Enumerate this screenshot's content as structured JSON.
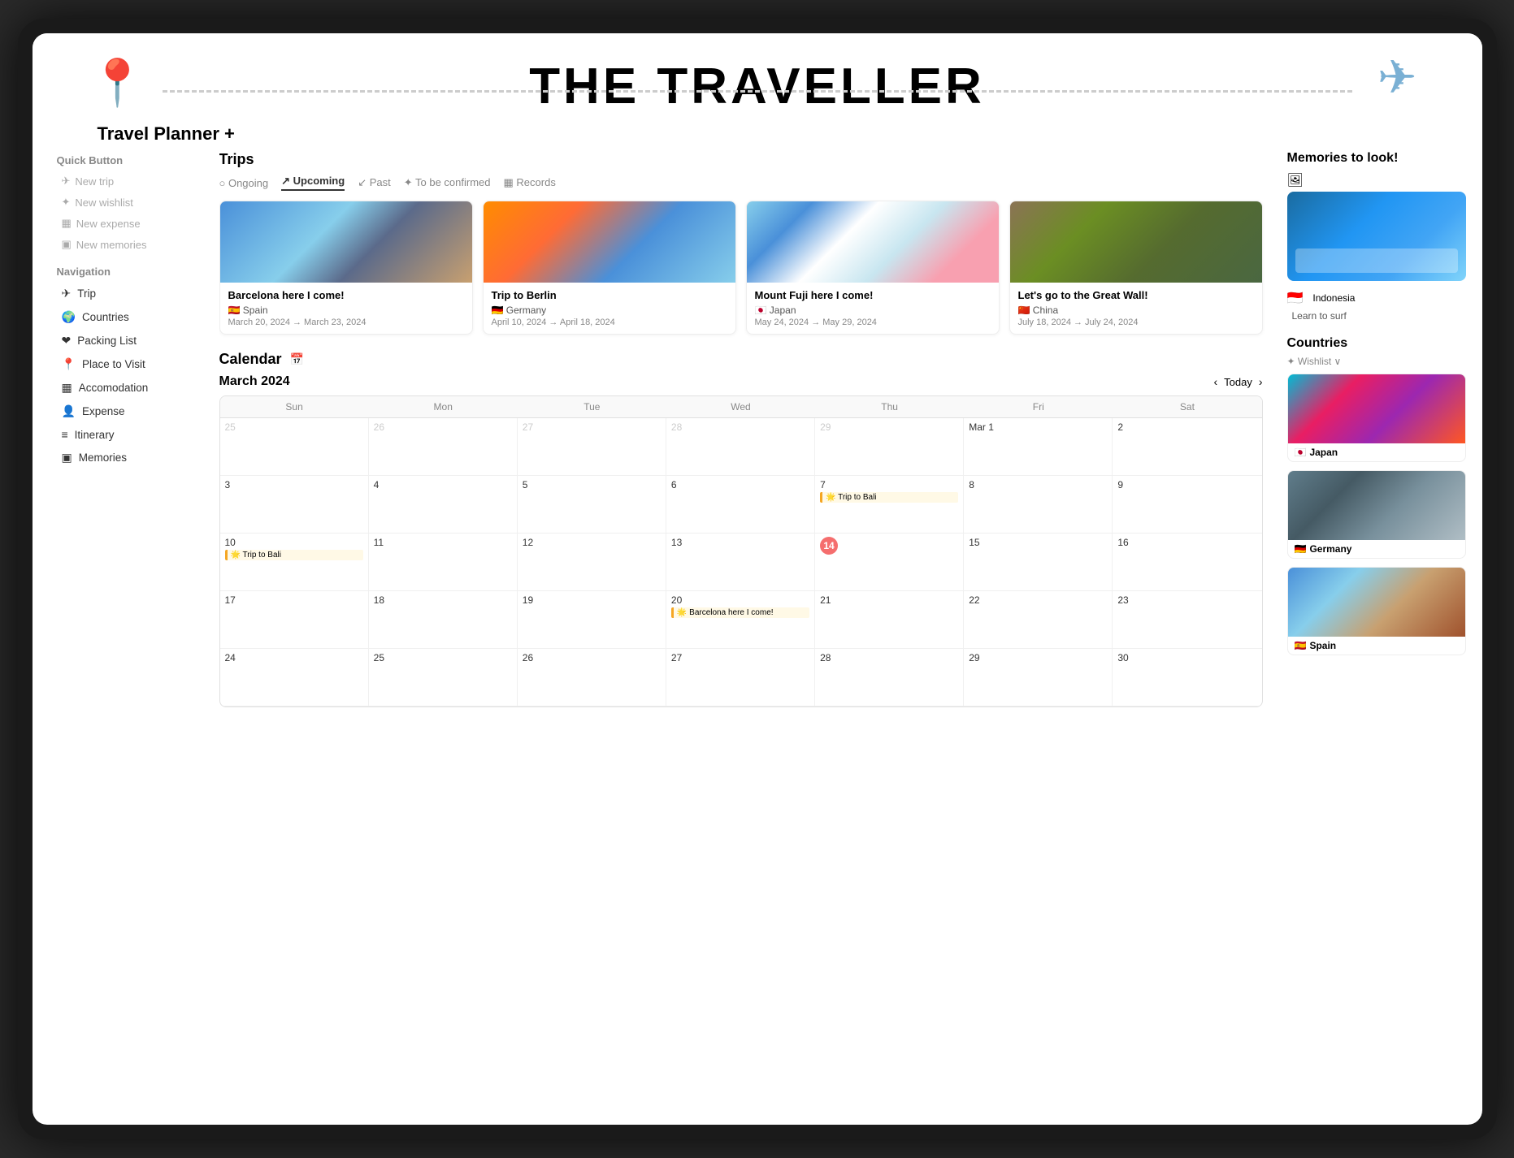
{
  "app": {
    "title": "THE TRAVELLER",
    "planner_title": "Travel Planner +"
  },
  "quick_button": {
    "label": "Quick Button",
    "items": [
      {
        "icon": "✈",
        "label": "New trip"
      },
      {
        "icon": "✦",
        "label": "New wishlist"
      },
      {
        "icon": "▦",
        "label": "New expense"
      },
      {
        "icon": "▣",
        "label": "New memories"
      }
    ]
  },
  "navigation": {
    "label": "Navigation",
    "items": [
      {
        "icon": "✈",
        "label": "Trip"
      },
      {
        "icon": "🌍",
        "label": "Countries"
      },
      {
        "icon": "❤",
        "label": "Packing List"
      },
      {
        "icon": "📍",
        "label": "Place to Visit"
      },
      {
        "icon": "▦",
        "label": "Accomodation"
      },
      {
        "icon": "👤",
        "label": "Expense"
      },
      {
        "icon": "≡",
        "label": "Itinerary"
      },
      {
        "icon": "▣",
        "label": "Memories"
      }
    ]
  },
  "trips": {
    "section_title": "Trips",
    "tabs": [
      {
        "label": "Ongoing",
        "icon": "○",
        "active": false
      },
      {
        "label": "Upcoming",
        "icon": "↗",
        "active": true
      },
      {
        "label": "Past",
        "icon": "↙",
        "active": false
      },
      {
        "label": "To be confirmed",
        "icon": "✦",
        "active": false
      },
      {
        "label": "Records",
        "icon": "▦",
        "active": false
      }
    ],
    "cards": [
      {
        "title": "Barcelona here I come!",
        "flag": "🇪🇸",
        "country": "Spain",
        "dates": "March 20, 2024 → March 23, 2024",
        "img_class": "img-barcelona",
        "icon": "😊"
      },
      {
        "title": "Trip to Berlin",
        "flag": "🇩🇪",
        "country": "Germany",
        "dates": "April 10, 2024 → April 18, 2024",
        "img_class": "img-berlin",
        "icon": "😊"
      },
      {
        "title": "Mount Fuji here I come!",
        "flag": "🇯🇵",
        "country": "Japan",
        "dates": "May 24, 2024 → May 29, 2024",
        "img_class": "img-fuji",
        "icon": "😊"
      },
      {
        "title": "Let's go to the Great Wall!",
        "flag": "🇨🇳",
        "country": "China",
        "dates": "July 18, 2024 → July 24, 2024",
        "img_class": "img-greatwall",
        "icon": "📄"
      }
    ]
  },
  "calendar": {
    "section_title": "Calendar",
    "month": "March 2024",
    "today_label": "Today",
    "day_labels": [
      "Sun",
      "Mon",
      "Tue",
      "Wed",
      "Thu",
      "Fri",
      "Sat"
    ],
    "weeks": [
      [
        {
          "date": "25",
          "other": true,
          "events": []
        },
        {
          "date": "26",
          "other": true,
          "events": []
        },
        {
          "date": "27",
          "other": true,
          "events": []
        },
        {
          "date": "28",
          "other": true,
          "events": []
        },
        {
          "date": "29",
          "other": true,
          "events": []
        },
        {
          "date": "Mar 1",
          "events": []
        },
        {
          "date": "2",
          "events": []
        }
      ],
      [
        {
          "date": "3",
          "events": []
        },
        {
          "date": "4",
          "events": []
        },
        {
          "date": "5",
          "events": []
        },
        {
          "date": "6",
          "events": []
        },
        {
          "date": "7",
          "events": [
            {
              "label": "Trip to Bali",
              "color": "#f5a623"
            }
          ]
        },
        {
          "date": "8",
          "events": []
        },
        {
          "date": "9",
          "events": []
        }
      ],
      [
        {
          "date": "10",
          "events": [
            {
              "label": "Trip to Bali",
              "color": "#f5a623"
            }
          ]
        },
        {
          "date": "11",
          "events": []
        },
        {
          "date": "12",
          "events": []
        },
        {
          "date": "13",
          "events": []
        },
        {
          "date": "14",
          "today": true,
          "events": []
        },
        {
          "date": "15",
          "events": []
        },
        {
          "date": "16",
          "events": []
        }
      ],
      [
        {
          "date": "17",
          "events": []
        },
        {
          "date": "18",
          "events": []
        },
        {
          "date": "19",
          "events": []
        },
        {
          "date": "20",
          "events": [
            {
              "label": "Barcelona here I come!",
              "color": "#f5a623"
            }
          ]
        },
        {
          "date": "21",
          "events": []
        },
        {
          "date": "22",
          "events": []
        },
        {
          "date": "23",
          "events": []
        }
      ],
      [
        {
          "date": "24",
          "events": []
        },
        {
          "date": "25",
          "events": []
        },
        {
          "date": "26",
          "events": []
        },
        {
          "date": "27",
          "events": []
        },
        {
          "date": "28",
          "events": []
        },
        {
          "date": "29",
          "events": []
        },
        {
          "date": "30",
          "events": []
        }
      ]
    ]
  },
  "memories": {
    "section_title": "Memories to look!",
    "country": "Indonesia",
    "description": "Learn to surf"
  },
  "countries": {
    "section_title": "Countries",
    "filter_label": "✦ Wishlist ∨",
    "items": [
      {
        "name": "Japan",
        "flag": "🇯🇵",
        "img_class": "img-japan-street"
      },
      {
        "name": "Germany",
        "flag": "🇩🇪",
        "img_class": "img-germany-city"
      },
      {
        "name": "Spain",
        "flag": "🇪🇸",
        "img_class": "img-spain-city"
      }
    ]
  }
}
